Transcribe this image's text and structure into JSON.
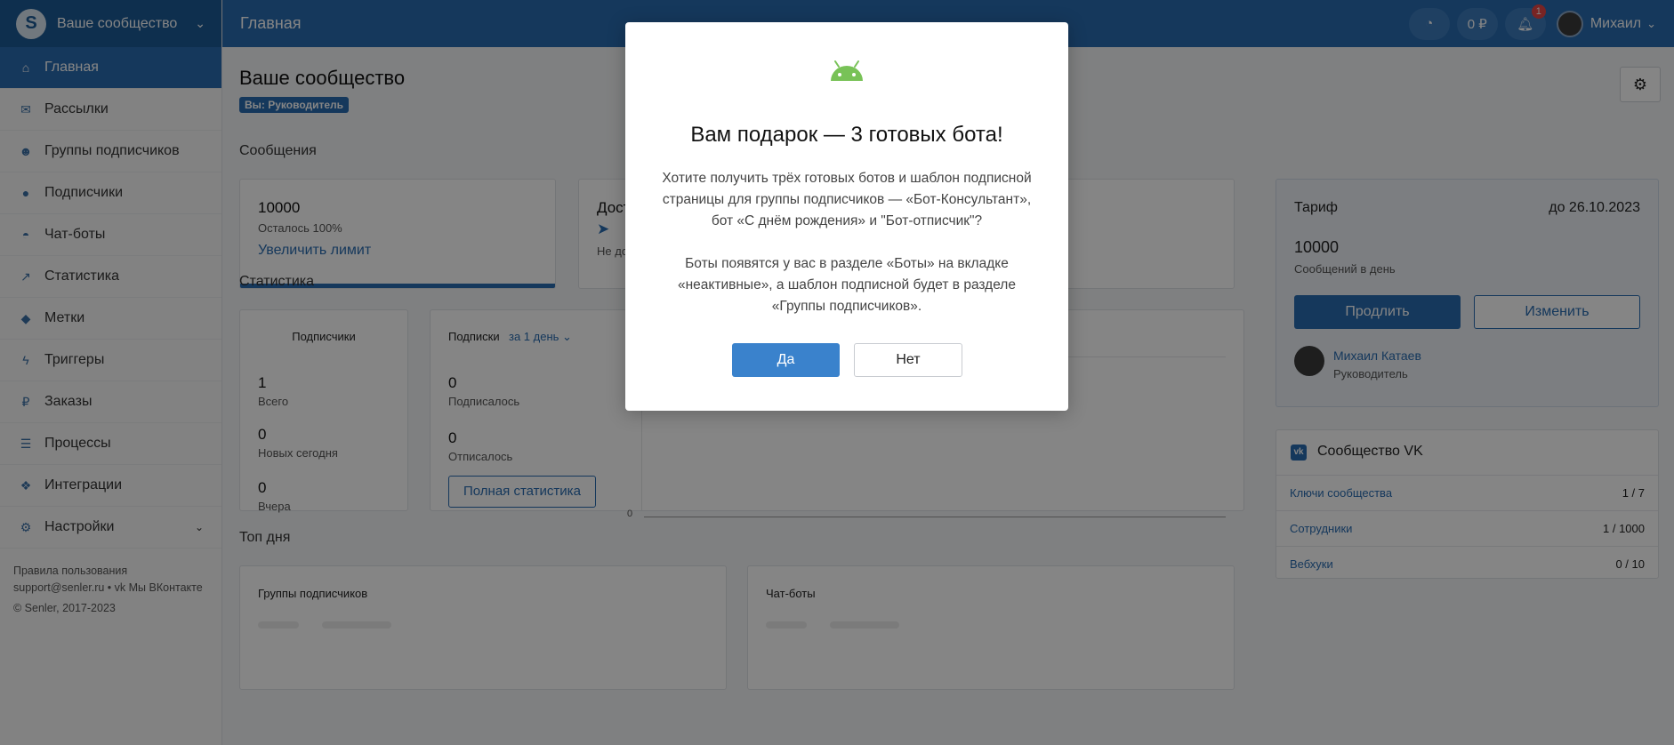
{
  "brand": {
    "name": "Ваше сообщество"
  },
  "sidebar": {
    "items": [
      {
        "label": "Главная",
        "icon": "home-icon",
        "glyph": "⌂"
      },
      {
        "label": "Рассылки",
        "icon": "envelope-icon",
        "glyph": "✉"
      },
      {
        "label": "Группы подписчиков",
        "icon": "users-icon",
        "glyph": "👥"
      },
      {
        "label": "Подписчики",
        "icon": "user-icon",
        "glyph": "●"
      },
      {
        "label": "Чат-боты",
        "icon": "android-icon",
        "glyph": "🤖"
      },
      {
        "label": "Статистика",
        "icon": "line-chart-icon",
        "glyph": "📈"
      },
      {
        "label": "Метки",
        "icon": "tag-icon",
        "glyph": "🏷"
      },
      {
        "label": "Триггеры",
        "icon": "bolt-icon",
        "glyph": "⚡"
      },
      {
        "label": "Заказы",
        "icon": "ruble-icon",
        "glyph": "₽"
      },
      {
        "label": "Процессы",
        "icon": "server-icon",
        "glyph": "☰"
      },
      {
        "label": "Интеграции",
        "icon": "cubes-icon",
        "glyph": "⚙"
      },
      {
        "label": "Настройки",
        "icon": "gears-icon",
        "glyph": "⚙"
      }
    ],
    "footer": {
      "terms": "Правила пользования",
      "support": "support@senler.ru",
      "vk": "Мы ВКонтакте",
      "copyright": "© Senler, 2017-2023"
    }
  },
  "topbar": {
    "title": "Главная",
    "balance": "0 ₽",
    "notifications_count": "1",
    "user_name": "Михаил"
  },
  "main": {
    "title": "Ваше сообщество",
    "role_badge": "Вы: Руководитель",
    "messages_section": "Сообщения",
    "limit_card": {
      "value": "10000",
      "remaining": "Осталось 100%",
      "link": "Увеличить лимит",
      "progress": 1.0
    },
    "stats_section": "Статистика",
    "subscribers_card": {
      "title": "Подписчики",
      "total_value": "1",
      "total_label": "Всего",
      "new_value": "0",
      "new_label": "Новых сегодня",
      "yesterday_value": "0",
      "yesterday_label": "Вчера"
    },
    "subs_chart_card": {
      "title": "Подписки",
      "period": "за 1 день",
      "subscribed_value": "0",
      "subscribed_label": "Подписалось",
      "unsubscribed_value": "0",
      "unsubscribed_label": "Отписалось",
      "full_stats_button": "Полная статистика",
      "axis_zero": "0"
    },
    "top_section": "Топ дня",
    "top_groups_title": "Группы подписчиков",
    "top_bots_title": "Чат-боты"
  },
  "tariff": {
    "label": "Тариф",
    "until": "до 26.10.2023",
    "value": "10000",
    "per_day": "Сообщений в день",
    "extend_button": "Продлить",
    "change_button": "Изменить",
    "owner_name": "Михаил Катаев",
    "owner_role": "Руководитель"
  },
  "vk_community": {
    "title": "Сообщество VK",
    "rows": [
      {
        "label": "Ключи сообщества",
        "value": "1 / 7"
      },
      {
        "label": "Сотрудники",
        "value": "1 / 1000"
      },
      {
        "label": "Вебхуки",
        "value": "0 / 10"
      }
    ]
  },
  "modal": {
    "title": "Вам подарок — 3 готовых бота!",
    "paragraph1": "Хотите получить трёх готовых ботов и шаблон подписной страницы для группы подписчиков — «Бот-Консультант», бот «С днём рождения» и \"Бот-отписчик\"?",
    "paragraph2": "Боты появятся у вас в разделе «Боты» на вкладке «неактивные», а шаблон подписной будет в разделе «Группы подписчиков».",
    "yes_button": "Да",
    "no_button": "Нет"
  },
  "colors": {
    "primary": "#2a6cb1",
    "android_green": "#78c257"
  }
}
